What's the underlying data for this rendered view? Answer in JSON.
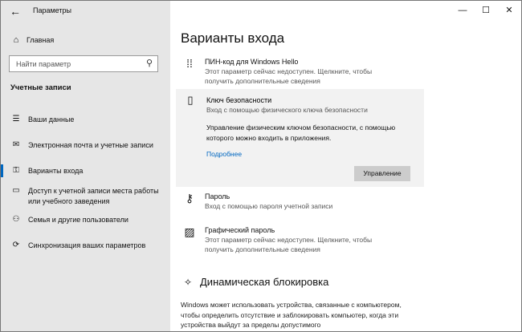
{
  "window": {
    "title": "Параметры",
    "back_icon": "arrow-left-icon",
    "minimize_glyph": "—",
    "maximize_glyph": "☐",
    "close_glyph": "✕"
  },
  "sidebar": {
    "home_label": "Главная",
    "search_placeholder": "Найти параметр",
    "section_title": "Учетные записи",
    "items": [
      {
        "label": "Ваши данные",
        "icon": "user-card-icon"
      },
      {
        "label": "Электронная почта и учетные записи",
        "icon": "mail-icon"
      },
      {
        "label": "Варианты входа",
        "icon": "key-icon",
        "active": true
      },
      {
        "label": "Доступ к учетной записи места работы или учебного заведения",
        "icon": "briefcase-icon"
      },
      {
        "label": "Семья и другие пользователи",
        "icon": "people-icon"
      },
      {
        "label": "Синхронизация ваших параметров",
        "icon": "sync-icon"
      }
    ]
  },
  "main": {
    "title": "Варианты входа",
    "options": {
      "pin": {
        "name": "ПИН-код для Windows Hello",
        "desc": "Этот параметр сейчас недоступен. Щелкните, чтобы получить дополнительные сведения"
      },
      "security_key": {
        "name": "Ключ безопасности",
        "desc": "Вход с помощью физического ключа безопасности",
        "manage_text": "Управление физическим ключом безопасности, с помощью которого можно входить в приложения.",
        "learn_more": "Подробнее",
        "button": "Управление"
      },
      "password": {
        "name": "Пароль",
        "desc": "Вход с помощью пароля учетной записи"
      },
      "picture_password": {
        "name": "Графический пароль",
        "desc": "Этот параметр сейчас недоступен. Щелкните, чтобы получить дополнительные сведения"
      }
    },
    "dynamic_lock": {
      "title": "Динамическая блокировка",
      "desc": "Windows может использовать устройства, связанные с компьютером, чтобы определить отсутствие и заблокировать компьютер, когда эти устройства выйдут за пределы допустимого"
    }
  }
}
